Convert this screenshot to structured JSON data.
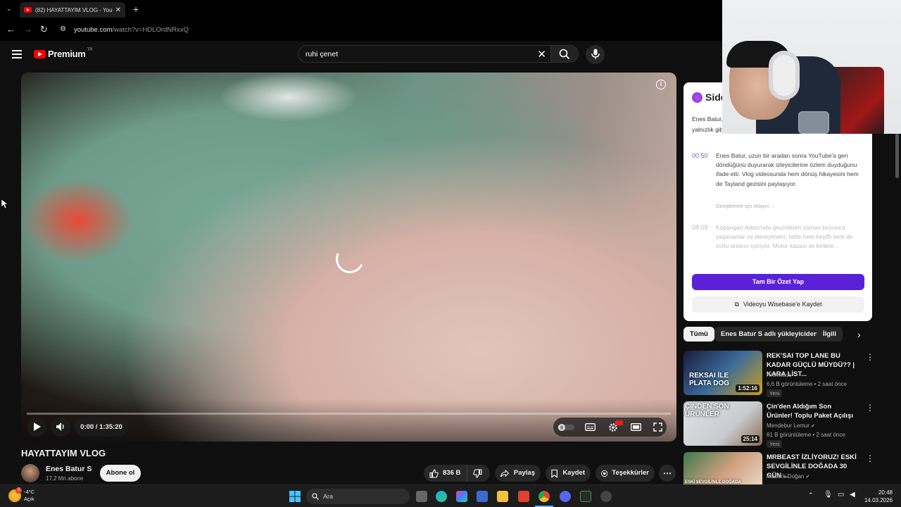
{
  "browser": {
    "tab_title": "(82) HAYATTAYIM VLOG - YouTube",
    "url_host": "youtube.com",
    "url_path": "/watch?v=HDLOrdNRxxQ"
  },
  "header": {
    "logo_text": "Premium",
    "region": "TR",
    "search_value": "ruhi çenet"
  },
  "player": {
    "time": "0:00 / 1:35:20"
  },
  "video": {
    "title": "HAYATTAYIM VLOG",
    "channel": "Enes Batur S",
    "subscribers": "17,2 Mn abone",
    "subscribe_label": "Abone ol",
    "likes": "836 B",
    "share_label": "Paylaş",
    "save_label": "Kaydet",
    "thanks_label": "Teşekkürler"
  },
  "summary_card": {
    "brand": "Side",
    "intro": "Enes Batur, ... vlog formatında ... anlatırken, depresyon ve yalnızlık gibi duygusal zorlukları...",
    "items": [
      {
        "time": "00:50",
        "text": "Enes Batur, uzun bir aradan sonra YouTube'a geri döndüğünü duyurarak izleyicilerine özlem duyduğunu ifade etti. Vlog videosunda hem dönüş hikayesini hem de Tayland gezisini paylaşıyor."
      },
      {
        "time": "08:09",
        "text": "Kopangan Adası'nda geçirdikleri zaman boyunca yaşananlar ve deneyimleri, tatile hem keyifli hem de zorlu anların içeriyor. Motor kazası ile birlikte..."
      }
    ],
    "expand_hint": "Genişletmek için tıklayın →",
    "primary_button": "Tam Bir Özet Yap",
    "secondary_button": "Videoyu Wisebase'e Kaydet"
  },
  "chips": [
    "Tümü",
    "Enes Batur S adlı yükleyiciden",
    "İlgili"
  ],
  "recommendations": [
    {
      "title": "REK'SAI TOP LANE BU KADAR GÜÇLÜ MÜYDÜ?? | KARA LİST...",
      "channel": "Archelaus",
      "meta": "6,6 B görüntüleme • 2 saat önce",
      "badge": "Yeni",
      "duration": "1:52:16",
      "thumb_text": "REKSAI İLE PLATA DOG"
    },
    {
      "title": "Çin'den Aldığım Son Ürünler! Toplu Paket Açılışı",
      "channel": "Mendebur Lemur",
      "meta": "61 B görüntüleme • 2 saat önce",
      "badge": "Yeni",
      "duration": "25:14",
      "thumb_text": "ÇİNDEN SON ÜRÜNLER"
    },
    {
      "title": "MRBEAST İZLİYORUZ! ESKİ SEVGİLİNLE DOĞADA 30 GÜN ...",
      "channel": "Ataberk Doğan",
      "meta": "",
      "badge": "",
      "duration": "",
      "thumb_text": "ESKİ SEVGİLİNLE DOĞADA"
    }
  ],
  "taskbar": {
    "weather_temp": "-4°C",
    "weather_desc": "Açık",
    "weather_badge": "3",
    "search_label": "Ara",
    "time": "20:48",
    "date": "14.03.2026"
  },
  "colors": {
    "youtube_red": "#ff0000",
    "summary_purple": "#5b21d8",
    "background": "#0f0f0f"
  }
}
